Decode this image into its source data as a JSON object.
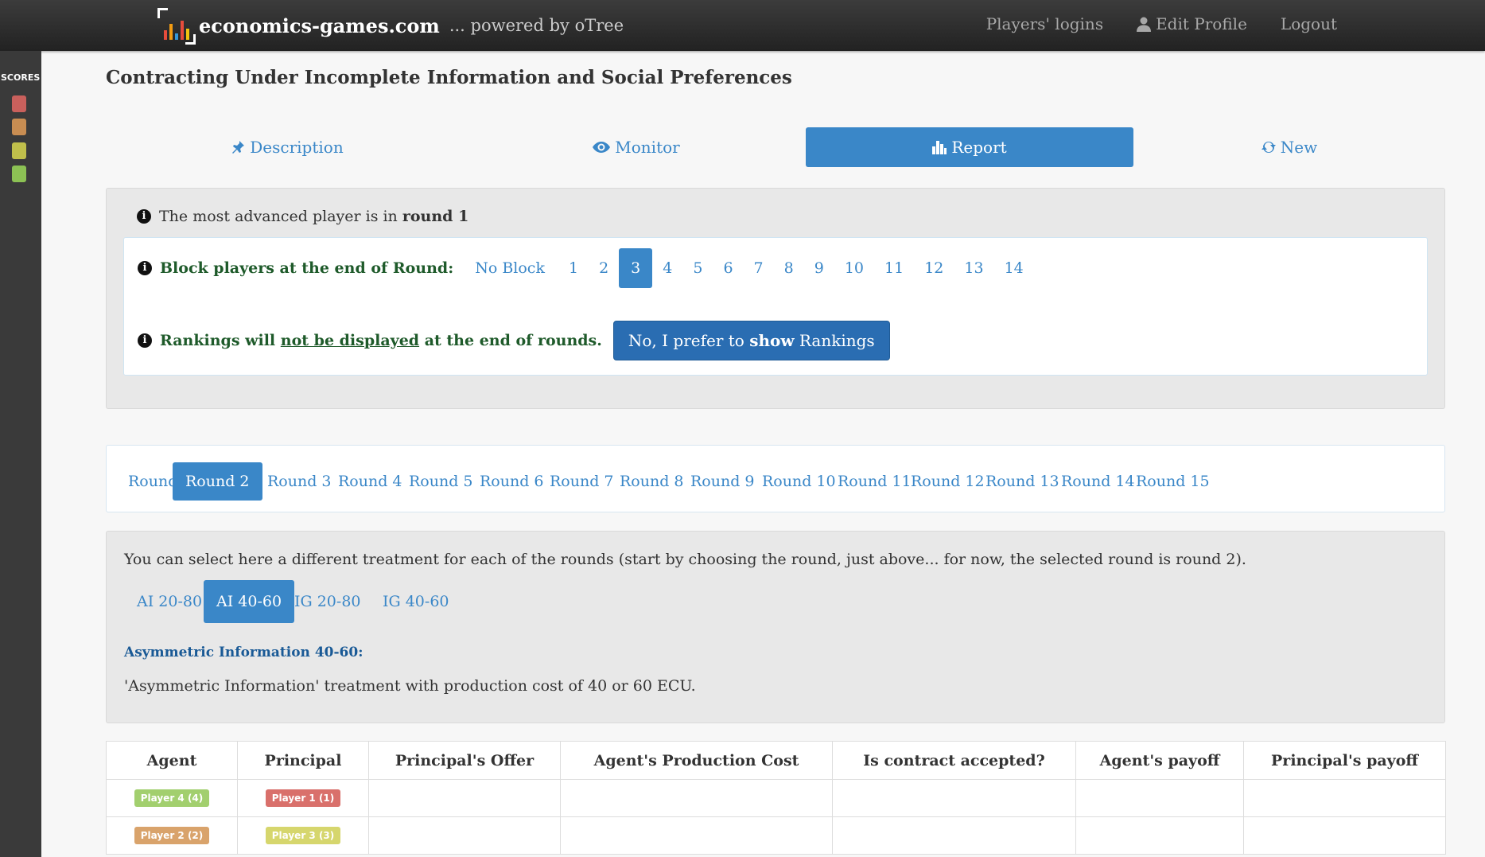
{
  "navbar": {
    "brand": "economics-games.com",
    "subtitle": "... powered by oTree",
    "links": [
      {
        "label": "Players' logins",
        "icon": ""
      },
      {
        "label": "Edit Profile",
        "icon": "user-icon"
      },
      {
        "label": "Logout",
        "icon": ""
      }
    ]
  },
  "sidebar": {
    "label": "SCORES",
    "colors": [
      "#c9605c",
      "#c88d52",
      "#c0bf4b",
      "#8cc154"
    ]
  },
  "page": {
    "title": "Contracting Under Incomplete Information and Social Preferences"
  },
  "main_tabs": [
    {
      "label": "Description",
      "icon": "pin-icon",
      "active": false
    },
    {
      "label": "Monitor",
      "icon": "eye-icon",
      "active": false
    },
    {
      "label": "Report",
      "icon": "bar-chart-icon",
      "active": true
    },
    {
      "label": "New",
      "icon": "refresh-icon",
      "active": false
    }
  ],
  "status": {
    "advanced_prefix": "The most advanced player is in",
    "advanced_round": "round 1",
    "block_label": "Block players at the end of Round:",
    "block_options": [
      "No Block",
      "1",
      "2",
      "3",
      "4",
      "5",
      "6",
      "7",
      "8",
      "9",
      "10",
      "11",
      "12",
      "13",
      "14"
    ],
    "block_active": "3",
    "rank_prefix": "Rankings will",
    "rank_underlined": "not be displayed",
    "rank_suffix": "at the end of rounds.",
    "rank_button_prefix": "No, I prefer to",
    "rank_button_bold": "show",
    "rank_button_suffix": "Rankings"
  },
  "rounds": {
    "items": [
      "Round 1",
      "Round 2",
      "Round 3",
      "Round 4",
      "Round 5",
      "Round 6",
      "Round 7",
      "Round 8",
      "Round 9",
      "Round 10",
      "Round 11",
      "Round 12",
      "Round 13",
      "Round 14",
      "Round 15"
    ],
    "active": "Round 2"
  },
  "treatment": {
    "intro": "You can select here a different treatment for each of the rounds (start by choosing the round, just above... for now, the selected round is round 2).",
    "options": [
      "AI 20-80",
      "AI 40-60",
      "IG 20-80",
      "IG 40-60"
    ],
    "active": "AI 40-60",
    "name": "Asymmetric Information 40-60:",
    "description": "'Asymmetric Information' treatment with production cost of 40 or 60 ECU."
  },
  "table": {
    "headers": [
      "Agent",
      "Principal",
      "Principal's Offer",
      "Agent's Production Cost",
      "Is contract accepted?",
      "Agent's payoff",
      "Principal's payoff"
    ],
    "rows": [
      {
        "agent": "Player 4 (4)",
        "agent_color": "#a2cf6e",
        "principal": "Player 1 (1)",
        "principal_color": "#d9706b"
      },
      {
        "agent": "Player 2 (2)",
        "agent_color": "#d9a36b",
        "principal": "Player 3 (3)",
        "principal_color": "#d6d66d"
      }
    ]
  }
}
